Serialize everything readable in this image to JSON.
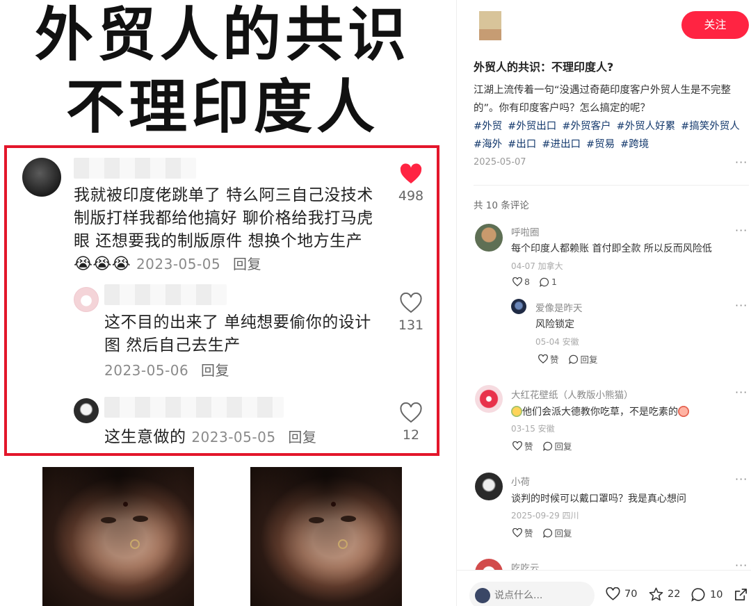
{
  "post_image": {
    "headline_line1": "外贸人的共识",
    "headline_line2": "不理印度人",
    "comments": [
      {
        "username_blurred": "Charles L",
        "text": "我就被印度佬跳单了 特么阿三自己没技术 制版打样我都给他搞好 聊价格给我打马虎眼 还想要我的制版原件 想换个地方生产",
        "emoji": "😭😭😭",
        "date": "2023-05-05",
        "reply_label": "回复",
        "likes": "498",
        "liked": true
      },
      {
        "username_blurred": "gold mcmu",
        "text": "这不目的出来了 单纯想要偷你的设计图 然后自己去生产",
        "date": "2023-05-06",
        "reply_label": "回复",
        "likes": "131",
        "liked": false
      },
      {
        "username_blurred": "小红薯64A06B4B 作者",
        "text": "这生意做的",
        "date": "2023-05-05",
        "reply_label": "回复",
        "likes": "12",
        "liked": false
      }
    ]
  },
  "panel": {
    "follow_label": "关注",
    "title": "外贸人的共识：不理印度人?",
    "body": "江湖上流传着一句“没遇过奇葩印度客户外贸人生是不完整的”。你有印度客户吗？怎么搞定的呢？",
    "tags": [
      "#外贸",
      "#外贸出口",
      "#外贸客户",
      "#外贸人好累",
      "#搞笑外贸人",
      "#海外",
      "#出口",
      "#进出口",
      "#贸易",
      "#跨境"
    ],
    "date": "2025-05-07",
    "more_icon": "···",
    "comment_count": "共 10 条评论",
    "comments": [
      {
        "name": "呼啦圈",
        "text": "每个印度人都赖账 首付即全款 所以反而风险低",
        "meta": "04-07 加拿大",
        "likes": "8",
        "replies": "1",
        "sub": {
          "name": "爱像是昨天",
          "text": "风险锁定",
          "meta": "05-04 安徽",
          "like_label": "赞",
          "reply_label": "回复"
        }
      },
      {
        "name": "大红花壁纸（人教版小熊猫）",
        "text": "他们会派大德教你吃草，不是吃素的",
        "meta": "03-15 安徽",
        "like_label": "赞",
        "reply_label": "回复"
      },
      {
        "name": "小荷",
        "text": "谈判的时候可以戴口罩吗？我是真心想问",
        "meta": "2025-09-29 四川",
        "like_label": "赞",
        "reply_label": "回复"
      },
      {
        "name": "吃吃云"
      }
    ],
    "bottom": {
      "input_placeholder": "说点什么...",
      "likes": "70",
      "stars": "22",
      "comments": "10"
    }
  },
  "colors": {
    "accent": "#ff2442",
    "highlight_box": "#e3162b",
    "tag": "#13386c",
    "liked_heart": "#ff2442"
  },
  "icons": [
    "heart-icon",
    "heart-outline-icon",
    "comment-icon",
    "star-icon",
    "share-icon",
    "more-icon"
  ]
}
